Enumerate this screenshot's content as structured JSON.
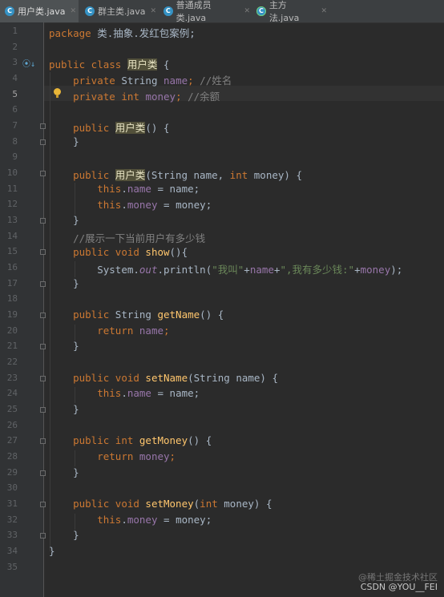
{
  "tabs": [
    {
      "label": "用户类.java",
      "active": true,
      "icon": "class-icon"
    },
    {
      "label": "群主类.java",
      "active": false,
      "icon": "class-icon"
    },
    {
      "label": "普通成员类.java",
      "active": false,
      "icon": "class-icon"
    },
    {
      "label": "主方法.java",
      "active": false,
      "icon": "main-class-icon"
    }
  ],
  "current_line": 5,
  "lines": [
    "1",
    "2",
    "3",
    "4",
    "5",
    "6",
    "7",
    "8",
    "9",
    "10",
    "11",
    "12",
    "13",
    "14",
    "15",
    "16",
    "17",
    "18",
    "19",
    "20",
    "21",
    "22",
    "23",
    "24",
    "25",
    "26",
    "27",
    "28",
    "29",
    "30",
    "31",
    "32",
    "33",
    "34",
    "35"
  ],
  "code": {
    "l1_pkg": "package",
    "l1_name": " 类.抽象.发红包案例;",
    "l3_public": "public",
    "l3_class": " class ",
    "l3_name": "用户类",
    "l3_brace": " {",
    "l4_private": "private",
    "l4_type": " String ",
    "l4_field": "name",
    "l4_semi": ";",
    "l4_comment": " //姓名",
    "l5_private": "private",
    "l5_type": " int ",
    "l5_field": "money",
    "l5_semi": ";",
    "l5_comment": " //余额",
    "l7_public": "public",
    "l7_name": "用户类",
    "l7_rest": "() {",
    "l8": "}",
    "l10_public": "public",
    "l10_name": "用户类",
    "l10_a": "(String name, ",
    "l10_int": "int",
    "l10_b": " money) {",
    "l11_this": "this",
    "l11_dot": ".",
    "l11_field": "name",
    "l11_rest": " = name;",
    "l12_this": "this",
    "l12_dot": ".",
    "l12_field": "money",
    "l12_rest": " = money;",
    "l13": "}",
    "l14_comment": "//展示一下当前用户有多少钱",
    "l15_public": "public",
    "l15_void": " void ",
    "l15_name": "show",
    "l15_rest": "(){",
    "l16_a": "System.",
    "l16_out": "out",
    "l16_b": ".println(",
    "l16_s1": "\"我叫\"",
    "l16_c": "+",
    "l16_f1": "name",
    "l16_d": "+",
    "l16_s2": "\",我有多少钱:\"",
    "l16_e": "+",
    "l16_f2": "money",
    "l16_f": ");",
    "l17": "}",
    "l19_public": "public",
    "l19_type": " String ",
    "l19_name": "getName",
    "l19_rest": "() {",
    "l20_return": "return",
    "l20_field": " name",
    "l20_semi": ";",
    "l21": "}",
    "l23_public": "public",
    "l23_void": " void ",
    "l23_name": "setName",
    "l23_rest": "(String name) {",
    "l24_this": "this",
    "l24_dot": ".",
    "l24_field": "name",
    "l24_rest": " = name;",
    "l25": "}",
    "l27_public": "public",
    "l27_int": " int ",
    "l27_name": "getMoney",
    "l27_rest": "() {",
    "l28_return": "return",
    "l28_field": " money",
    "l28_semi": ";",
    "l29": "}",
    "l31_public": "public",
    "l31_void": " void ",
    "l31_name": "setMoney",
    "l31_a": "(",
    "l31_int": "int",
    "l31_b": " money) {",
    "l32_this": "this",
    "l32_dot": ".",
    "l32_field": "money",
    "l32_rest": " = money;",
    "l33": "}",
    "l34": "}"
  },
  "watermark": {
    "faint": "@稀土掘金技术社区",
    "main": "CSDN @YOU__FEI"
  },
  "colors": {
    "background": "#2b2b2b",
    "keyword": "#cc7832",
    "field": "#9876aa",
    "method": "#ffc66d",
    "string": "#6a8759",
    "comment": "#808080"
  }
}
